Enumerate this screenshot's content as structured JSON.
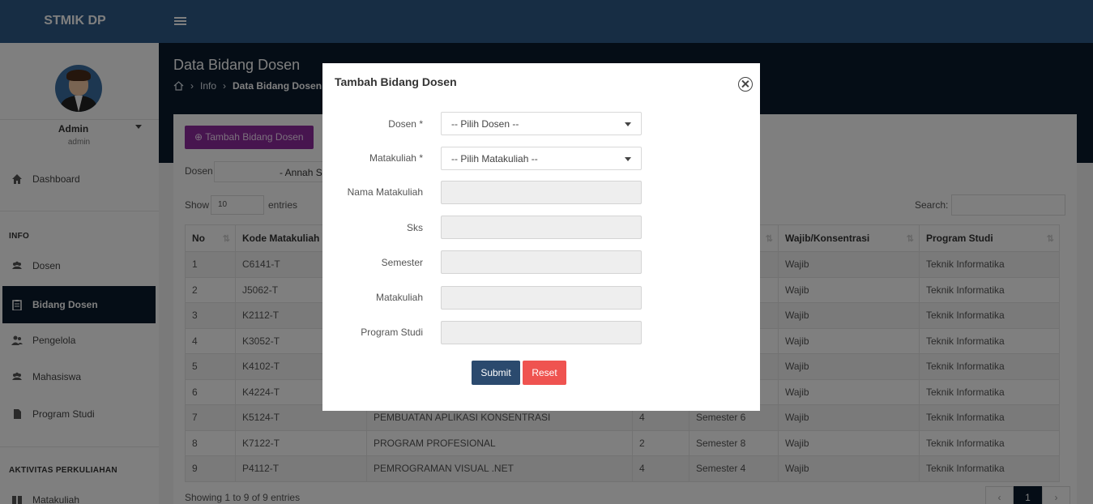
{
  "app": {
    "brand": "STMIK DP"
  },
  "user": {
    "name": "Admin",
    "role": "admin"
  },
  "sidebar": {
    "items": [
      {
        "label": "Dashboard",
        "icon": "home-icon"
      },
      {
        "label": "Dosen",
        "icon": "users-icon"
      },
      {
        "label": "Bidang Dosen",
        "icon": "clipboard-icon"
      },
      {
        "label": "Pengelola",
        "icon": "user-group-icon"
      },
      {
        "label": "Mahasiswa",
        "icon": "users-icon"
      },
      {
        "label": "Program Studi",
        "icon": "file-icon"
      },
      {
        "label": "Matakuliah",
        "icon": "book-icon"
      }
    ],
    "sections": {
      "info": "INFO",
      "aktivitas": "AKTIVITAS PERKULIAHAN"
    }
  },
  "page": {
    "title": "Data Bidang Dosen",
    "breadcrumb": {
      "level1": "Info",
      "level2": "Data Bidang Dosen"
    }
  },
  "card": {
    "add_button": "Tambah Bidang Dosen",
    "filter_label": "Dosen",
    "filter_value": "- Annah S",
    "show_label": "Show",
    "show_value": "10",
    "entries_label": "entries",
    "search_label": "Search:",
    "info": "Showing 1 to 9 of 9 entries",
    "page_current": "1"
  },
  "table": {
    "headers": [
      "No",
      "Kode Matakuliah",
      "",
      "",
      "",
      "Wajib/Konsentrasi",
      "Program Studi"
    ],
    "rows": [
      [
        "1",
        "C6141-T",
        "",
        "",
        "",
        "Wajib",
        "Teknik Informatika"
      ],
      [
        "2",
        "J5062-T",
        "",
        "",
        "",
        "Wajib",
        "Teknik Informatika"
      ],
      [
        "3",
        "K2112-T",
        "",
        "",
        "",
        "Wajib",
        "Teknik Informatika"
      ],
      [
        "4",
        "K3052-T",
        "",
        "",
        "",
        "Wajib",
        "Teknik Informatika"
      ],
      [
        "5",
        "K4102-T",
        "",
        "",
        "",
        "Wajib",
        "Teknik Informatika"
      ],
      [
        "6",
        "K4224-T",
        "",
        "",
        "",
        "Wajib",
        "Teknik Informatika"
      ],
      [
        "7",
        "K5124-T",
        "PEMBUATAN APLIKASI KONSENTRASI",
        "4",
        "Semester 6",
        "Wajib",
        "Teknik Informatika"
      ],
      [
        "8",
        "K7122-T",
        "PROGRAM PROFESIONAL",
        "2",
        "Semester 8",
        "Wajib",
        "Teknik Informatika"
      ],
      [
        "9",
        "P4112-T",
        "PEMROGRAMAN VISUAL .NET",
        "4",
        "Semester 4",
        "Wajib",
        "Teknik Informatika"
      ]
    ]
  },
  "modal": {
    "title": "Tambah Bidang Dosen",
    "fields": {
      "dosen": {
        "label": "Dosen *",
        "value": "-- Pilih Dosen --"
      },
      "matakuliah": {
        "label": "Matakuliah *",
        "value": "-- Pilih Matakuliah --"
      },
      "nama_matakuliah": {
        "label": "Nama Matakuliah"
      },
      "sks": {
        "label": "Sks"
      },
      "semester": {
        "label": "Semester"
      },
      "matakuliah_type": {
        "label": "Matakuliah"
      },
      "program_studi": {
        "label": "Program Studi"
      }
    },
    "submit": "Submit",
    "reset": "Reset"
  },
  "colors": {
    "topbar": "#2f5b88",
    "sidebar_active": "#0b1a2d",
    "add_button": "#8e2a9e",
    "submit": "#2b4a6e",
    "reset": "#ef5350"
  }
}
